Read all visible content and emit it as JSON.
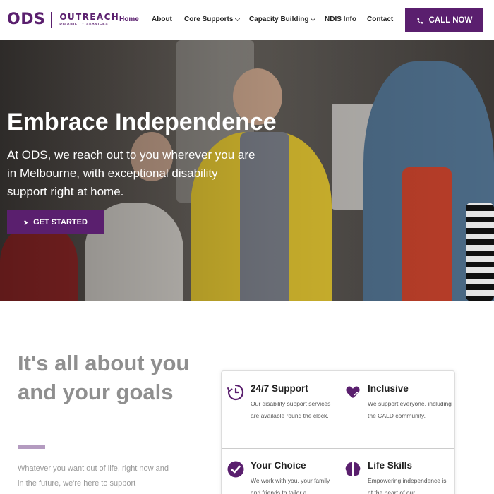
{
  "brand": {
    "short_name": "ODS",
    "name": "OUTREACH",
    "tagline": "DISABILITY SERVICES",
    "primary_color": "#5a1f6e"
  },
  "nav": {
    "items": [
      {
        "label": "Home",
        "active": true,
        "has_dropdown": false
      },
      {
        "label": "About",
        "active": false,
        "has_dropdown": false
      },
      {
        "label": "Core Supports",
        "active": false,
        "has_dropdown": true
      },
      {
        "label": "Capacity Building",
        "active": false,
        "has_dropdown": true
      },
      {
        "label": "NDIS Info",
        "active": false,
        "has_dropdown": false
      },
      {
        "label": "Contact",
        "active": false,
        "has_dropdown": false
      }
    ],
    "cta_label": "CALL NOW",
    "cta_icon": "phone-icon"
  },
  "hero": {
    "title": "Embrace Independence",
    "description": "At ODS, we reach out to you wherever you are in Melbourne, with exceptional disability support right at home.",
    "button_label": "GET STARTED",
    "button_icon": "chevron-right-icon"
  },
  "about": {
    "heading": "It's all about you and your goals",
    "text": "Whatever you want out of life, right now and in the future, we're here to support"
  },
  "features": [
    {
      "title": "24/7 Support",
      "text": "Our disability support services are available round the clock.",
      "icon": "clock-icon"
    },
    {
      "title": "Inclusive",
      "text": "We support everyone, including the CALD community.",
      "icon": "heart-hand-icon"
    },
    {
      "title": "Your Choice",
      "text": "We work with you, your family and friends to tailor a",
      "icon": "check-circle-icon"
    },
    {
      "title": "Life Skills",
      "text": "Empowering independence is at the heart of our",
      "icon": "brain-icon"
    }
  ]
}
